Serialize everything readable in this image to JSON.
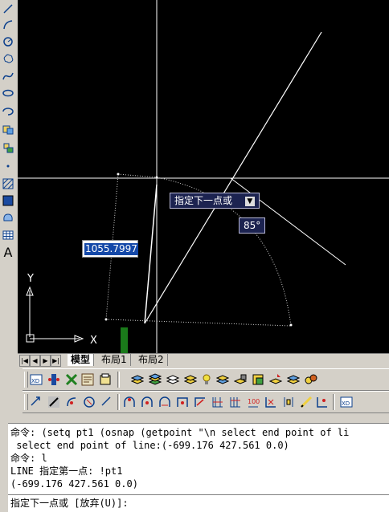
{
  "left_toolbar": {
    "icons": [
      "line-icon",
      "arc-icon",
      "circle-icon",
      "revcloud-icon",
      "spline-icon",
      "ellipse-icon",
      "ellipse-arc-icon",
      "insert-block-icon",
      "make-block-icon",
      "point-icon",
      "hatch-icon",
      "gradient-icon",
      "region-icon",
      "table-icon",
      "multiline-text-icon"
    ],
    "text_button": "A"
  },
  "canvas": {
    "background": "#000000",
    "tooltip_prompt": "指定下一点或",
    "tooltip_angle": "85°",
    "dynamic_input_value": "1055.7997",
    "ucs_x_label": "X",
    "ucs_y_label": "Y"
  },
  "layout_tabs": {
    "nav": [
      "|◀",
      "◀",
      "▶",
      "▶|"
    ],
    "tabs": [
      "模型",
      "布局1",
      "布局2"
    ],
    "active": "模型"
  },
  "toolbar_row1": {
    "icons": [
      "xref-icon",
      "insert-icon",
      "tool-palette-icon",
      "design-center-icon",
      "properties-icon",
      "layer-manager-icon",
      "layer-states-icon",
      "layer-previous-icon",
      "layer-isolate-icon",
      "light-bulb-icon",
      "layer-freeze-icon",
      "layer-lock-icon",
      "layer-color-icon",
      "layer-match-icon",
      "layer-walk-icon",
      "layer-merge-icon"
    ]
  },
  "toolbar_row2": {
    "icons": [
      "move-icon",
      "copy-icon",
      "mirror-icon",
      "offset-icon",
      "array-icon",
      "rotate-icon",
      "scale-icon",
      "stretch-icon",
      "trim-icon",
      "extend-icon",
      "break-icon",
      "join-icon",
      "chamfer-icon",
      "fillet-icon",
      "explode-icon",
      "edit-icon",
      "xdata-icon",
      "dim-icon"
    ]
  },
  "command": {
    "lines": [
      "命令: (setq pt1 (osnap (getpoint \"\\n select end point of li",
      " select end point of line:(-699.176 427.561 0.0)",
      "命令: l",
      "LINE 指定第一点: !pt1",
      "(-699.176 427.561 0.0)"
    ],
    "prompt": "指定下一点或 [放弃(U)]:"
  }
}
